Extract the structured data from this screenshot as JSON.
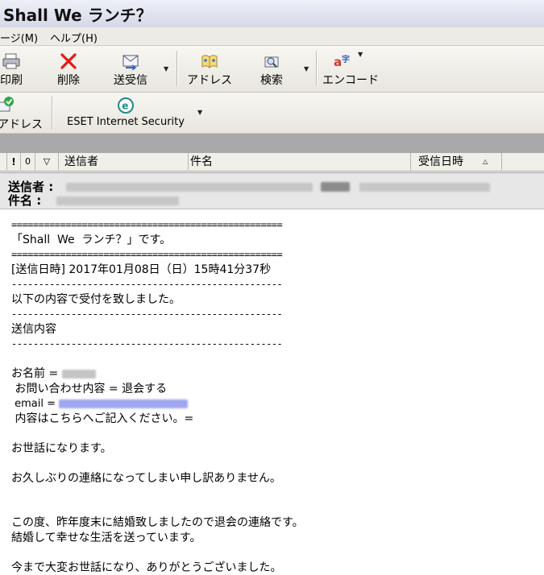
{
  "window": {
    "title": "Shall We ランチ？"
  },
  "menu": {
    "items": [
      "ージ(M)",
      "ヘルプ(H)"
    ]
  },
  "toolbar": {
    "print": "印刷",
    "delete": "削除",
    "send_receive": "送受信",
    "address": "アドレス",
    "search": "検索",
    "encode": "エンコード",
    "address2": "アドレス",
    "eset": "ESET Internet Security"
  },
  "list_header": {
    "flag": "!",
    "attach": "0",
    "filter": "▽",
    "from": "送信者",
    "subject": "件名",
    "received": "受信日時",
    "sort": "△"
  },
  "message_header": {
    "from_label": "送信者 :",
    "subject_label": "件名 :"
  },
  "message_body": {
    "rule_double": "==================================================",
    "subject_line": "「Shall  We  ランチ？」です。",
    "sent_time": "[送信日時] 2017年01月08日（日）15時41分37秒",
    "rule_single": "--------------------------------------------------",
    "accepted": "以下の内容で受付を致しました。",
    "content_heading": "送信内容",
    "name_label": "お名前 = ",
    "inquiry": " お問い合わせ内容 = 退会する",
    "email_label": " email = ",
    "details": " 内容はこちらへご記入ください。=",
    "p1": "お世話になります。",
    "p2": "お久しぶりの連絡になってしまい申し訳ありません。",
    "p3a": "この度、昨年度末に結婚致しましたので退会の連絡です。",
    "p3b": "結婚して幸せな生活を送っています。",
    "p4": "今まで大変お世話になり、ありがとうございました。"
  },
  "colors": {
    "delete_red": "#e01c14",
    "email_redaction": "#9fa6f0",
    "gray_bar": "#a9a9a9"
  }
}
